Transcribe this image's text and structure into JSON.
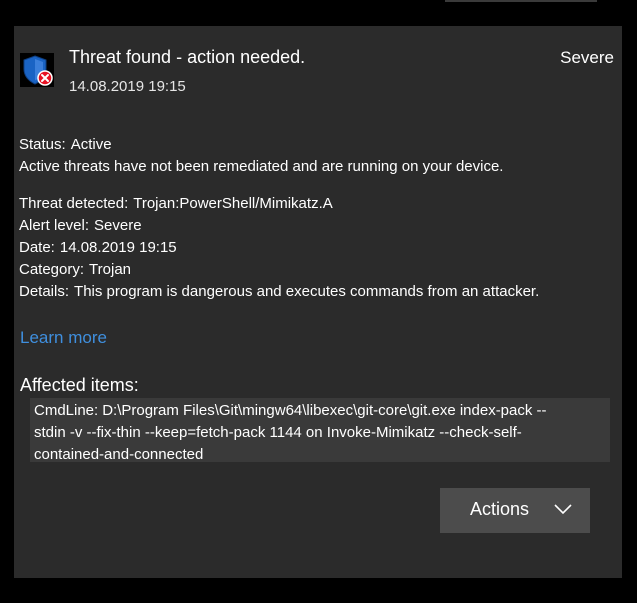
{
  "header": {
    "title": "Threat found - action needed.",
    "timestamp": "14.08.2019 19:15",
    "severity": "Severe",
    "icon": "shield-alert-icon"
  },
  "status": {
    "label": "Status:",
    "value": "Active",
    "description": "Active threats have not been remediated and are running on your device."
  },
  "details": {
    "threat_label": "Threat detected:",
    "threat_value": "Trojan:PowerShell/Mimikatz.A",
    "alert_label": "Alert level:",
    "alert_value": "Severe",
    "date_label": "Date:",
    "date_value": "14.08.2019 19:15",
    "category_label": "Category:",
    "category_value": "Trojan",
    "details_label": "Details:",
    "details_value": "This program is dangerous and executes commands from an attacker."
  },
  "learn_more": "Learn more",
  "affected": {
    "heading": "Affected items:",
    "cmd_label": "CmdLine:",
    "cmd_line1": "D:\\Program Files\\Git\\mingw64\\libexec\\git-core\\git.exe index-pack --",
    "cmd_line2": "stdin -v --fix-thin --keep=fetch-pack 1144 on Invoke-Mimikatz --check-self-",
    "cmd_line3": "contained-and-connected"
  },
  "actions": {
    "label": "Actions",
    "icon": "chevron-down-icon"
  },
  "colors": {
    "card_bg": "#2b2b2b",
    "link": "#3f8fde",
    "button_bg": "#4c4c4c",
    "shield_blue": "#1a63c4",
    "alert_red": "#e81123"
  }
}
